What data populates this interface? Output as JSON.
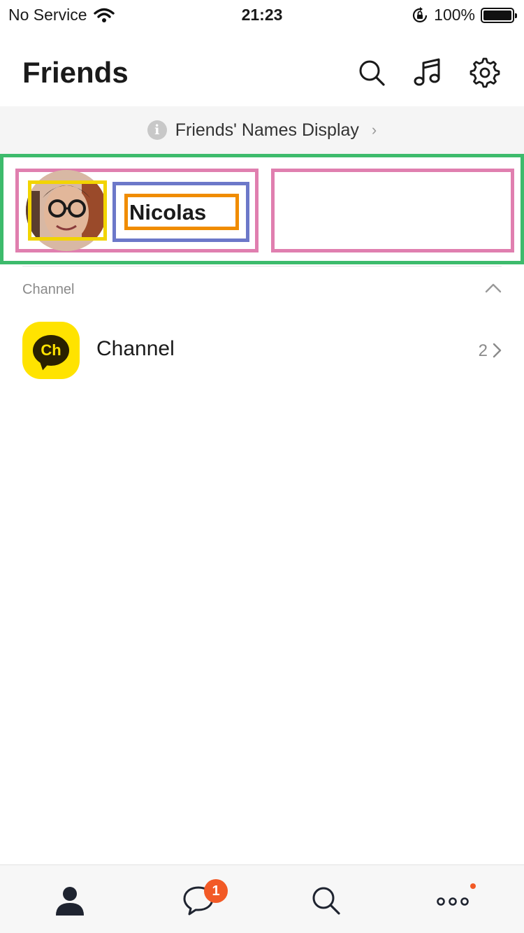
{
  "status_bar": {
    "carrier": "No Service",
    "time": "21:23",
    "battery_percent": "100%",
    "battery_level": 1.0
  },
  "header": {
    "title": "Friends",
    "icons": [
      "search-icon",
      "music-icon",
      "settings-icon"
    ]
  },
  "banner": {
    "text": "Friends' Names Display",
    "info_glyph": "i",
    "chevron": "›"
  },
  "profile": {
    "name": "Nicolas"
  },
  "channel_section": {
    "label": "Channel",
    "items": [
      {
        "logo_text": "Ch",
        "name": "Channel",
        "count": "2"
      }
    ]
  },
  "tab_bar": {
    "tabs": [
      "friends-tab",
      "chats-tab",
      "search-tab",
      "more-tab"
    ],
    "chats_badge": "1"
  },
  "colors": {
    "accent_orange": "#f25a26",
    "channel_yellow": "#ffe300",
    "highlight_green": "#3dbb6c",
    "highlight_pink": "#e07faf",
    "highlight_blue": "#6c78c9",
    "highlight_orange": "#f08c00",
    "highlight_yellow": "#f2d400"
  }
}
